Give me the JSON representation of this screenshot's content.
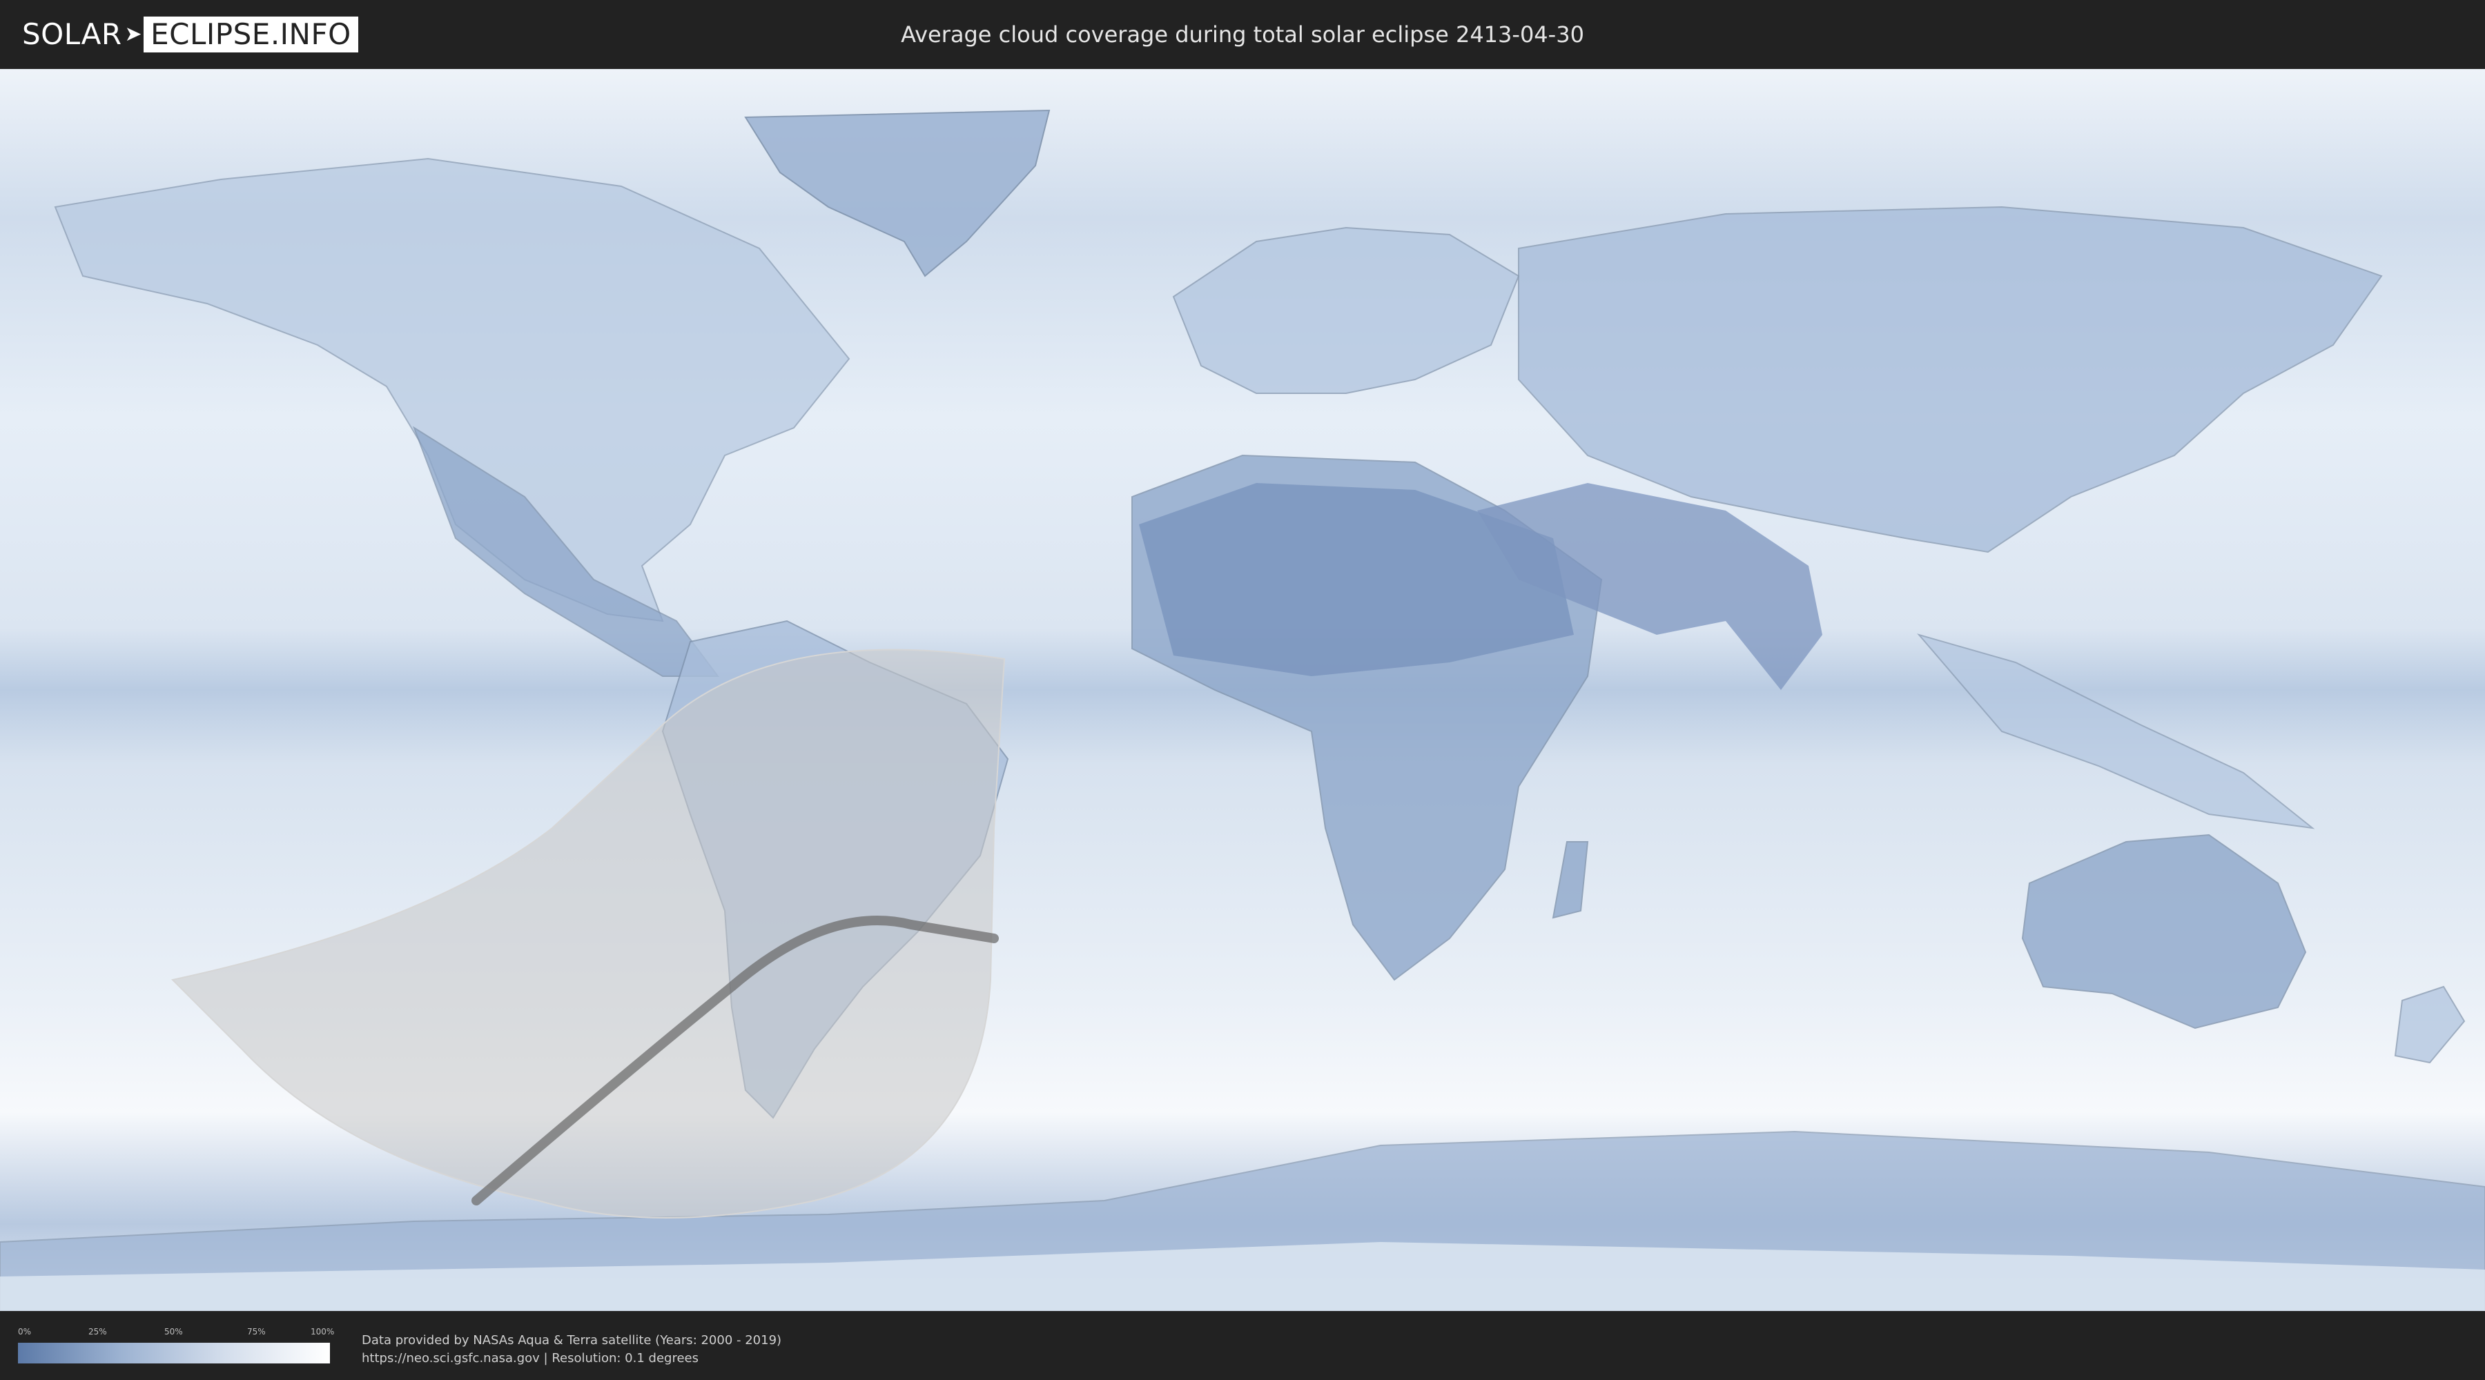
{
  "header": {
    "logo_part1": "SOLAR",
    "logo_part2": "ECLIPSE.INFO",
    "title": "Average cloud coverage during total solar eclipse 2413-04-30"
  },
  "legend": {
    "ticks": [
      "0%",
      "25%",
      "50%",
      "75%",
      "100%"
    ],
    "colors": {
      "low": "#5c7aa8",
      "high": "#ffffff"
    }
  },
  "footer": {
    "credit_line1": "Data provided by NASAs Aqua & Terra satellite (Years: 2000 - 2019)",
    "credit_line2": "https://neo.sci.gsfc.nasa.gov | Resolution: 0.1 degrees"
  },
  "map": {
    "projection": "equirectangular",
    "background_color": "#d9e4f1",
    "low_cloud_color": "#7e98c2",
    "penumbra_color": "#c8c8c8",
    "totality_path_color": "#6e6e6e"
  }
}
